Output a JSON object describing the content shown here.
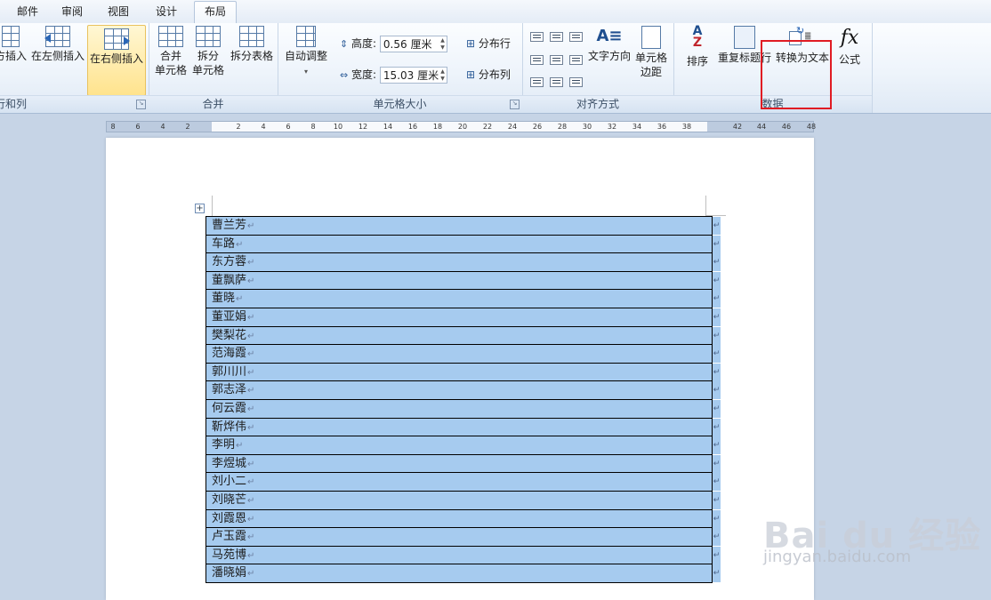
{
  "tabs": [
    {
      "label": "邮件"
    },
    {
      "label": "审阅"
    },
    {
      "label": "视图"
    },
    {
      "label": "设计"
    },
    {
      "label": "布局"
    }
  ],
  "ribbon": {
    "rows_cols": {
      "label": "行和列",
      "btn_insert_below": "方插入",
      "btn_insert_left": "在左侧插入",
      "btn_insert_right": "在右侧插入"
    },
    "merge": {
      "label": "合并",
      "btn_merge_1": "合并",
      "btn_merge_2": "单元格",
      "btn_split_cells_1": "拆分",
      "btn_split_cells_2": "单元格",
      "btn_split_table": "拆分表格"
    },
    "cell_size": {
      "label": "单元格大小",
      "btn_autofit": "自动调整",
      "height_label": "高度:",
      "height_value": "0.56 厘米",
      "width_label": "宽度:",
      "width_value": "15.03 厘米",
      "btn_distribute_rows": "分布行",
      "btn_distribute_cols": "分布列"
    },
    "alignment": {
      "label": "对齐方式",
      "btn_text_direction": "文字方向",
      "btn_cell_margins_1": "单元格",
      "btn_cell_margins_2": "边距"
    },
    "data": {
      "label": "数据",
      "btn_sort": "排序",
      "btn_repeat_header": "重复标题行",
      "btn_convert_to_text": "转换为文本",
      "btn_formula": "公式"
    }
  },
  "ruler": {
    "ticks": [
      "8",
      "6",
      "4",
      "2",
      "2",
      "4",
      "6",
      "8",
      "10",
      "12",
      "14",
      "16",
      "18",
      "20",
      "22",
      "24",
      "26",
      "28",
      "30",
      "32",
      "34",
      "36",
      "38",
      "42",
      "44",
      "46",
      "48"
    ]
  },
  "table": {
    "rows": [
      "曹兰芳",
      "车路",
      "东方蓉",
      "董飘萨",
      "董晓",
      "董亚娟",
      "樊梨花",
      "范海霞",
      "郭川川",
      "郭志泽",
      "何云霞",
      "靳烨伟",
      "李明",
      "李煜城",
      "刘小二",
      "刘晓芒",
      "刘霞恩",
      "卢玉霞",
      "马苑博",
      "潘晓娟"
    ],
    "paragraph_mark": "↵",
    "end_of_row_mark": "↵"
  },
  "watermark": {
    "brand": "Bai du 经验",
    "url": "jingyan.baidu.com"
  }
}
